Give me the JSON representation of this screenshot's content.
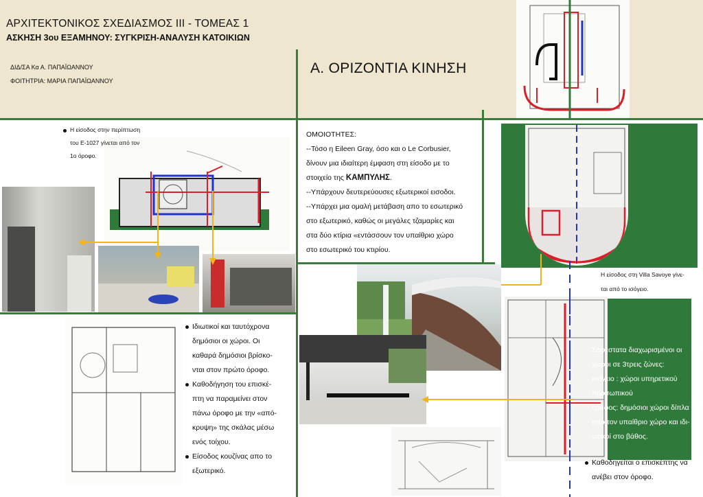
{
  "header": {
    "course": "ΑΡΧΙΤΕΚΤΟΝΙΚΟΣ ΣΧΕΔΙΑΣΜΟΣ ΙΙΙ - ΤΟΜΕΑΣ 1",
    "assignment": "ΑΣΚΗΣΗ 3ου ΕΞΑΜΗΝΟΥ: ΣΥΓΚΡΙΣΗ-ΑΝΑΛΥΣΗ ΚΑΤΟΙΚΙΩΝ",
    "teacher": "ΔΙΔ/ΣΑ Κα Α. ΠΑΠΑΪΩΑΝΝΟΥ",
    "student": "ΦΟΙΤΗΤΡΙΑ: ΜΑΡΙΑ ΠΑΠΑΪΩΑΝΝΟΥ",
    "section_title": "Α. ΟΡΙΖΟΝΤΙΑ ΚΙΝΗΣΗ"
  },
  "e1027": {
    "entrance_lines": [
      "Η είσοδος στην περίπτωση",
      "του Ε-1027 γίνεται από τον",
      "1ο όροφο."
    ],
    "notes": [
      [
        "Ιδιωτικοί και ταυτόχρονα",
        "δημόσιοι οι χώροι. Οι",
        "καθαρά δημόσιοι βρίσκο-",
        "νται στον πρώτο όροφο."
      ],
      [
        "Καθοδήγηση του επισκέ-",
        "πτη να παραμείνει στον",
        "πάνω όροφο με την «από-",
        "κρυψη» της σκάλας μέσω",
        "ενός τοίχου."
      ],
      [
        "Είσοδος κουζίνας απο το",
        "εξωτερικό."
      ]
    ]
  },
  "similarities": {
    "heading": "ΟΜΟΙΟΤΗΤΕΣ:",
    "p1": [
      "--Τόσο η Eileen Gray, όσο και ο Le Corbusier,",
      "δίνουν μια ιδιαίτερη έμφαση στη είσοδο με το",
      "στοιχείο της "
    ],
    "p1_bold": "ΚΑΜΠΥΛΗΣ",
    "p1_end": ".",
    "p2": "--Υπάρχουν δευτερεύουσες εξωτερικοί εισοδοι.",
    "p3": [
      "--Υπάρχει μια ομαλή μετάβαση απο το εσωτερικό",
      "στο εξωτερικό, καθώς οι μεγάλες τζαμαρίες και",
      "στα δύο κτίρια «εντάσσουν τον υπαίθριο χώρο",
      "στο εσωτερικό του κτιρίου."
    ]
  },
  "savoye": {
    "entrance_lines": [
      "Η είσοδος στη Villa Savoye γίνε-",
      "ται από το ισόγειο."
    ],
    "zones": [
      "Σαφέστατα διαχωρισμένοι οι",
      "χώροι σε 3τρεις ζώνες:",
      "ισόγειο : χώροι υπηρετικού",
      "προσωπικού",
      "όροφος: δημόσιοι χώροι δίπλα",
      "απο τον υπαίθριο χώρο και ιδι-",
      "ωτικοί στο βάθος."
    ],
    "guide_lines": [
      "Καθοδηγείται ο επισκέπτης να",
      "ανέβει στον όροφο."
    ]
  },
  "colors": {
    "background": "#efe6cf",
    "frame_green": "#3d7a3d",
    "block_green": "#2f7a3a",
    "arrow_yellow": "#f2b418",
    "path_red": "#d81f2a",
    "path_blue": "#2233cc"
  }
}
